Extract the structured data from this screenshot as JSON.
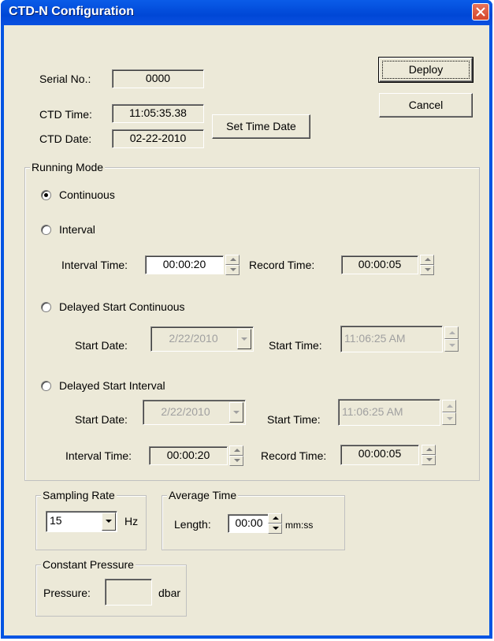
{
  "window": {
    "title": "CTD-N Configuration"
  },
  "serial": {
    "label": "Serial No.:",
    "value": "0000"
  },
  "ctd_time": {
    "label": "CTD Time:",
    "value": "11:05:35.38"
  },
  "ctd_date": {
    "label": "CTD Date:",
    "value": "02-22-2010"
  },
  "buttons": {
    "deploy": "Deploy",
    "cancel": "Cancel",
    "set_time_date": "Set Time Date"
  },
  "running_mode": {
    "title": "Running Mode",
    "continuous": "Continuous",
    "interval": "Interval",
    "interval_time_label": "Interval Time:",
    "interval_time_value": "00:00:20",
    "record_time_label": "Record Time:",
    "record_time_value": "00:00:05",
    "delayed_continuous": "Delayed Start Continuous",
    "dc_start_date_label": "Start Date:",
    "dc_start_date_value": "2/22/2010",
    "dc_start_time_label": "Start Time:",
    "dc_start_time_value": "11:06:25 AM",
    "delayed_interval": "Delayed Start Interval",
    "di_start_date_label": "Start Date:",
    "di_start_date_value": "2/22/2010",
    "di_start_time_label": "Start Time:",
    "di_start_time_value": "11:06:25 AM",
    "di_interval_time_label": "Interval Time:",
    "di_interval_time_value": "00:00:20",
    "di_record_time_label": "Record Time:",
    "di_record_time_value": "00:00:05",
    "selected": "Continuous"
  },
  "sampling_rate": {
    "title": "Sampling Rate",
    "value": "15",
    "unit": "Hz"
  },
  "average_time": {
    "title": "Average Time",
    "length_label": "Length:",
    "value": "00:00",
    "unit": "mm:ss"
  },
  "constant_pressure": {
    "title": "Constant Pressure",
    "label": "Pressure:",
    "value": "",
    "unit": "dbar"
  },
  "colors": {
    "titlebar": "#0054e3",
    "dialog_bg": "#ece9d8",
    "close": "#d6462b"
  }
}
